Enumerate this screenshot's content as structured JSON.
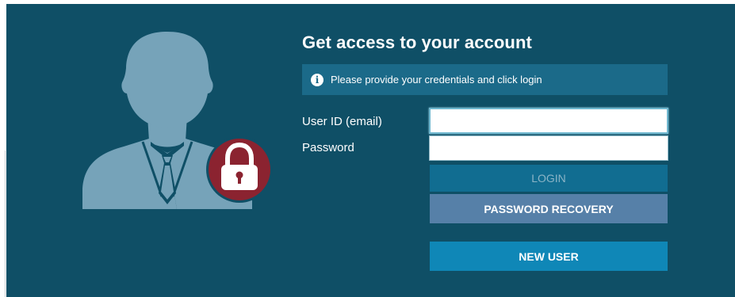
{
  "login": {
    "title": "Get access to your account",
    "info_icon": "info-circle-icon",
    "info_text": "Please provide your credentials and click login",
    "user_label": "User ID (email)",
    "user_value": "",
    "password_label": "Password",
    "password_value": "",
    "login_button": "LOGIN",
    "recovery_button": "PASSWORD RECOVERY",
    "new_user_button": "NEW USER"
  },
  "illustration": {
    "person_icon": "user-silhouette-icon",
    "lock_icon": "padlock-icon"
  },
  "colors": {
    "panel_background": "#0f4f66",
    "info_banner": "#1b6a89",
    "silhouette": "#76a3b9",
    "lock_badge": "#8b2330",
    "login_button": "#116d91",
    "recovery_button": "#5680a8",
    "new_user_button": "#0f87b7"
  }
}
